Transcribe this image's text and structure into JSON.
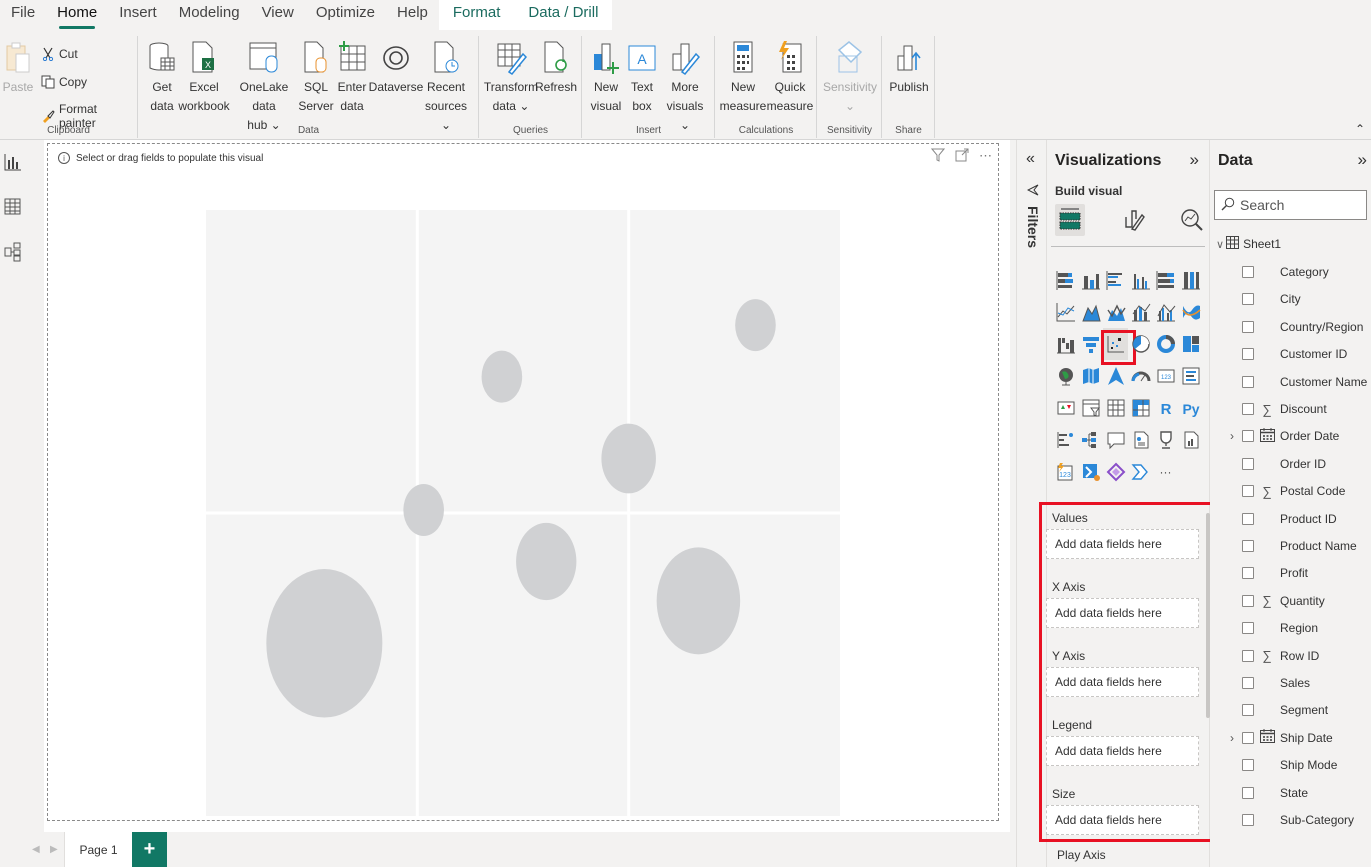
{
  "menu": {
    "tabs": [
      {
        "label": "File",
        "active": false
      },
      {
        "label": "Home",
        "active": true
      },
      {
        "label": "Insert",
        "active": false
      },
      {
        "label": "Modeling",
        "active": false
      },
      {
        "label": "View",
        "active": false
      },
      {
        "label": "Optimize",
        "active": false
      },
      {
        "label": "Help",
        "active": false
      },
      {
        "label": "Format",
        "contextual": true
      },
      {
        "label": "Data / Drill",
        "contextual": true
      }
    ]
  },
  "ribbon": {
    "clipboard": {
      "label": "Clipboard",
      "paste": "Paste",
      "cut": "Cut",
      "copy": "Copy",
      "format_painter": "Format painter"
    },
    "data": {
      "label": "Data",
      "get_data": [
        "Get",
        "data"
      ],
      "excel": [
        "Excel",
        "workbook"
      ],
      "onelake": [
        "OneLake data",
        "hub"
      ],
      "sql": [
        "SQL",
        "Server"
      ],
      "enter_data": [
        "Enter",
        "data"
      ],
      "dataverse": [
        "Dataverse",
        ""
      ],
      "recent": [
        "Recent",
        "sources"
      ]
    },
    "queries": {
      "label": "Queries",
      "transform": [
        "Transform",
        "data"
      ],
      "refresh": [
        "Refresh",
        ""
      ]
    },
    "insert": {
      "label": "Insert",
      "new_visual": [
        "New",
        "visual"
      ],
      "text_box": [
        "Text",
        "box"
      ],
      "more_visuals": [
        "More",
        "visuals"
      ]
    },
    "calculations": {
      "label": "Calculations",
      "new_measure": [
        "New",
        "measure"
      ],
      "quick_measure": [
        "Quick",
        "measure"
      ]
    },
    "sensitivity": {
      "label": "Sensitivity",
      "button": "Sensitivity"
    },
    "share": {
      "label": "Share",
      "publish": "Publish"
    }
  },
  "canvas": {
    "hint": "Select or drag fields to populate this visual",
    "page_tab": "Page 1",
    "add_page": "+"
  },
  "filters": {
    "label": "Filters"
  },
  "visualizations": {
    "title": "Visualizations",
    "build_label": "Build visual",
    "selected_visual": "scatter-chart",
    "wells": [
      {
        "label": "Values",
        "placeholder": "Add data fields here"
      },
      {
        "label": "X Axis",
        "placeholder": "Add data fields here"
      },
      {
        "label": "Y Axis",
        "placeholder": "Add data fields here"
      },
      {
        "label": "Legend",
        "placeholder": "Add data fields here"
      },
      {
        "label": "Size",
        "placeholder": "Add data fields here"
      }
    ],
    "play_axis": "Play Axis",
    "gallery": [
      "stacked-bar",
      "stacked-column",
      "clustered-bar",
      "clustered-column",
      "100-stacked-bar",
      "100-stacked-column",
      "line",
      "area",
      "stacked-area",
      "line-stacked-column",
      "line-clustered-column",
      "ribbon",
      "waterfall",
      "funnel",
      "scatter",
      "pie",
      "donut",
      "treemap",
      "map",
      "filled-map",
      "azure-map",
      "gauge",
      "card",
      "multi-row-card",
      "kpi",
      "slicer",
      "table",
      "matrix",
      "r-visual",
      "python-visual",
      "key-influencers",
      "decomposition-tree",
      "qa",
      "smart-narrative",
      "goals",
      "paginated-report",
      "power-apps",
      "power-automate",
      "fabric",
      "narrative",
      "more"
    ],
    "gallery_text": {
      "card": "123",
      "r-visual": "R",
      "python-visual": "Py",
      "more": "···"
    }
  },
  "data_pane": {
    "title": "Data",
    "search_placeholder": "Search",
    "table": "Sheet1",
    "fields": [
      {
        "name": "Category",
        "type": ""
      },
      {
        "name": "City",
        "type": ""
      },
      {
        "name": "Country/Region",
        "type": ""
      },
      {
        "name": "Customer ID",
        "type": ""
      },
      {
        "name": "Customer Name",
        "type": ""
      },
      {
        "name": "Discount",
        "type": "sum"
      },
      {
        "name": "Order Date",
        "type": "date",
        "expandable": true
      },
      {
        "name": "Order ID",
        "type": ""
      },
      {
        "name": "Postal Code",
        "type": "sum"
      },
      {
        "name": "Product ID",
        "type": ""
      },
      {
        "name": "Product Name",
        "type": ""
      },
      {
        "name": "Profit",
        "type": ""
      },
      {
        "name": "Quantity",
        "type": "sum"
      },
      {
        "name": "Region",
        "type": ""
      },
      {
        "name": "Row ID",
        "type": "sum"
      },
      {
        "name": "Sales",
        "type": ""
      },
      {
        "name": "Segment",
        "type": ""
      },
      {
        "name": "Ship Date",
        "type": "date",
        "expandable": true
      },
      {
        "name": "Ship Mode",
        "type": ""
      },
      {
        "name": "State",
        "type": ""
      },
      {
        "name": "Sub-Category",
        "type": ""
      }
    ]
  },
  "placeholder_chart": {
    "type": "scatter",
    "description": "placeholder bubble preview (no data bound)",
    "xlim": [
      0,
      3
    ],
    "ylim": [
      0,
      2
    ],
    "bubbles": [
      {
        "x": 0.56,
        "y": 0.57,
        "size": 1.0
      },
      {
        "x": 1.03,
        "y": 1.01,
        "size": 0.35
      },
      {
        "x": 1.4,
        "y": 1.45,
        "size": 0.35
      },
      {
        "x": 1.61,
        "y": 0.84,
        "size": 0.52
      },
      {
        "x": 2.0,
        "y": 1.18,
        "size": 0.47
      },
      {
        "x": 2.33,
        "y": 0.71,
        "size": 0.72
      },
      {
        "x": 2.6,
        "y": 1.62,
        "size": 0.35
      }
    ],
    "colors": {
      "bubble": "#d0d1d3",
      "panel": "#f4f4f4",
      "grid": "#ffffff"
    }
  },
  "colors": {
    "accent": "#117865",
    "highlight": "#e81123"
  }
}
